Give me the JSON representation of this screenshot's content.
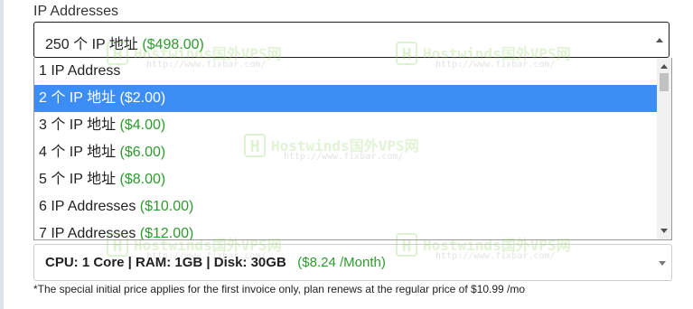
{
  "ip_addresses": {
    "label": "IP Addresses",
    "selected": {
      "text": "250 个 IP 地址",
      "price": "($498.00)"
    },
    "options": [
      {
        "text": "1 IP Address",
        "price": ""
      },
      {
        "text": "2 个 IP 地址",
        "price": "($2.00)"
      },
      {
        "text": "3 个 IP 地址",
        "price": "($4.00)"
      },
      {
        "text": "4 个 IP 地址",
        "price": "($6.00)"
      },
      {
        "text": "5 个 IP 地址",
        "price": "($8.00)"
      },
      {
        "text": "6 IP Addresses",
        "price": "($10.00)"
      },
      {
        "text": "7 IP Addresses",
        "price": "($12.00)"
      }
    ],
    "highlighted_option": "2 个 IP 地址"
  },
  "plan": {
    "selected": {
      "specs": "CPU: 1 Core | RAM: 1GB | Disk: 30GB",
      "price": "($8.24 /Month)"
    }
  },
  "note": "*The special initial price applies for the first invoice only, plan renews at the regular price of $10.99 /mo",
  "watermark": {
    "title": "Hostwinds国外VPS网",
    "url": "http://www.fixbar.com/",
    "logo_letter": "H"
  },
  "colors": {
    "highlight": "#3d8ef4",
    "price_green": "#2e9b2e"
  }
}
